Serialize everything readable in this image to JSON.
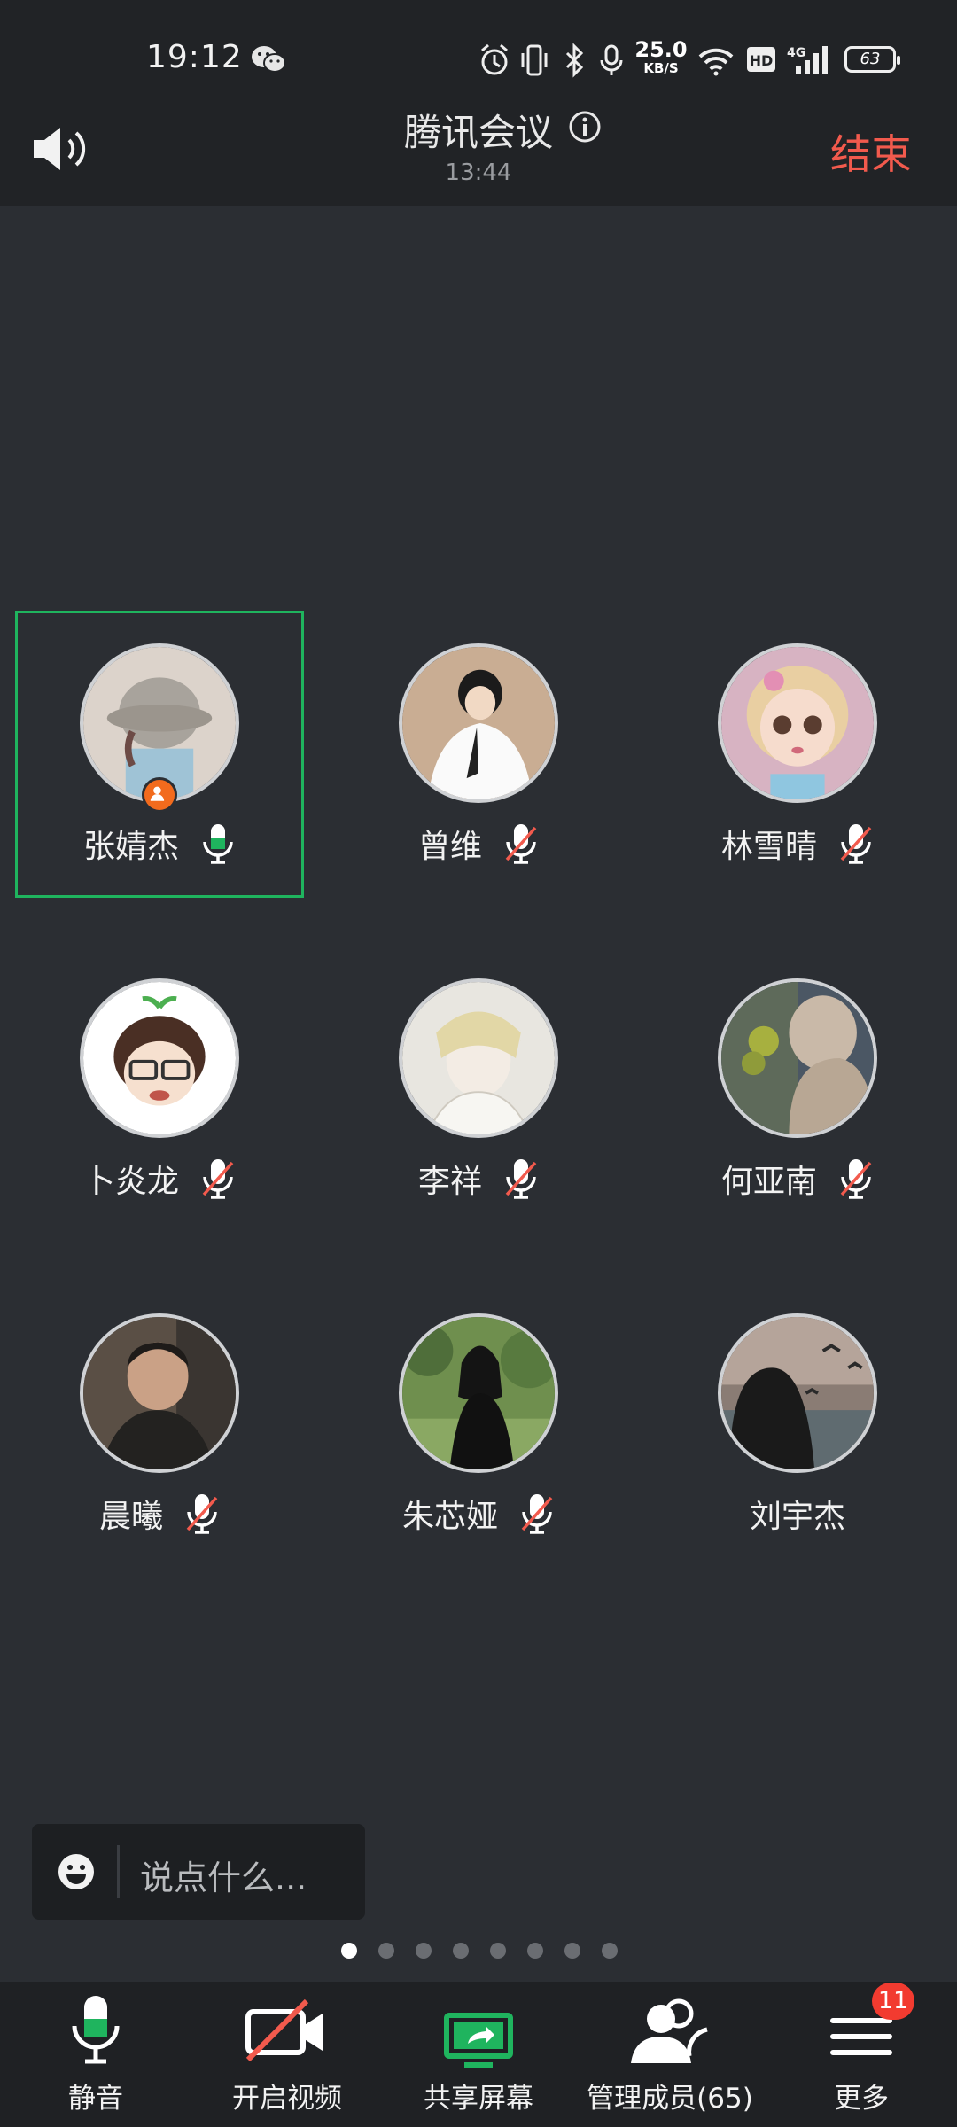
{
  "status_bar": {
    "time": "19:12",
    "net_speed_value": "25.0",
    "net_speed_unit": "KB/S",
    "battery": "63",
    "icons": [
      "wechat-icon",
      "alarm-icon",
      "vibrate-icon",
      "bluetooth-icon",
      "mic-icon",
      "wifi-icon",
      "hd-icon",
      "signal-4g-icon",
      "battery-icon"
    ]
  },
  "header": {
    "title": "腾讯会议",
    "elapsed": "13:44",
    "end_label": "结束"
  },
  "participants": [
    {
      "name": "张婧杰",
      "mic": "on",
      "host": true
    },
    {
      "name": "曾维",
      "mic": "muted"
    },
    {
      "name": "林雪晴",
      "mic": "muted"
    },
    {
      "name": "卜炎龙",
      "mic": "muted"
    },
    {
      "name": "李祥",
      "mic": "muted"
    },
    {
      "name": "何亚南",
      "mic": "muted"
    },
    {
      "name": "晨曦",
      "mic": "muted"
    },
    {
      "name": "朱芯娅",
      "mic": "muted"
    },
    {
      "name": "刘宇杰",
      "mic": "none"
    }
  ],
  "chat": {
    "placeholder": "说点什么..."
  },
  "pager": {
    "pages": 8,
    "current": 1
  },
  "toolbar": {
    "mute": "静音",
    "video": "开启视频",
    "share": "共享屏幕",
    "members": "管理成员(65)",
    "more": "更多",
    "more_badge": "11"
  },
  "colors": {
    "accent_green": "#1fb45e",
    "end_red": "#f25a4d",
    "background": "#2b2e33",
    "header": "#212326"
  }
}
